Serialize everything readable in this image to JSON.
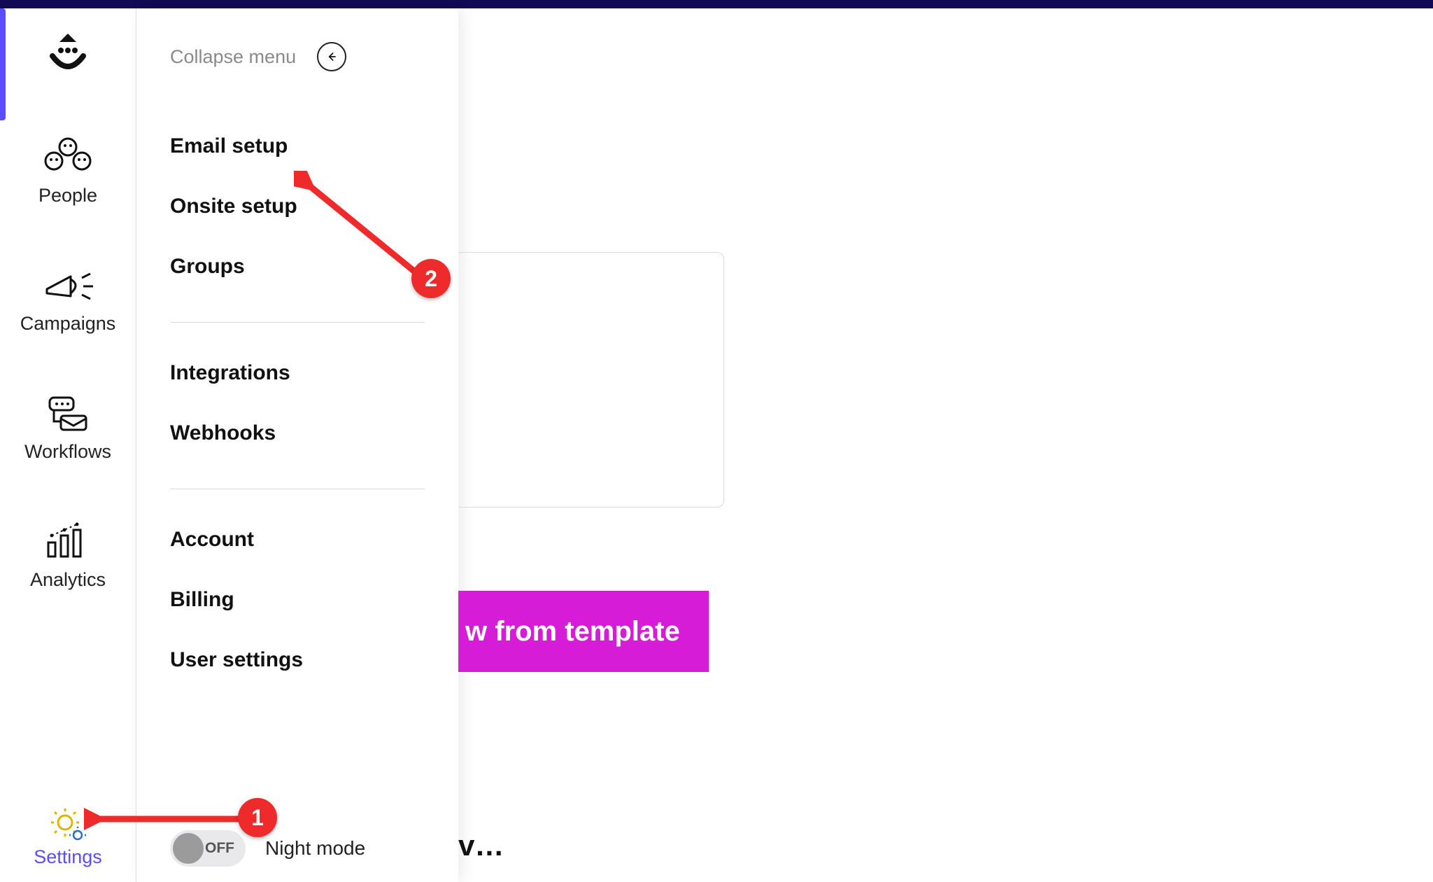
{
  "rail": {
    "items": [
      {
        "label": "People"
      },
      {
        "label": "Campaigns"
      },
      {
        "label": "Workflows"
      },
      {
        "label": "Analytics"
      }
    ],
    "settings_label": "Settings"
  },
  "panel": {
    "collapse_label": "Collapse menu",
    "links_group1": [
      "Email setup",
      "Onsite setup",
      "Groups"
    ],
    "links_group2": [
      "Integrations",
      "Webhooks"
    ],
    "links_group3": [
      "Account",
      "Billing",
      "User settings"
    ],
    "night_mode_label": "Night mode",
    "night_mode_state": "OFF"
  },
  "main": {
    "template_button_partial": "w from template",
    "truncated_text": "v…"
  },
  "annotations": {
    "badge1": "1",
    "badge2": "2"
  }
}
